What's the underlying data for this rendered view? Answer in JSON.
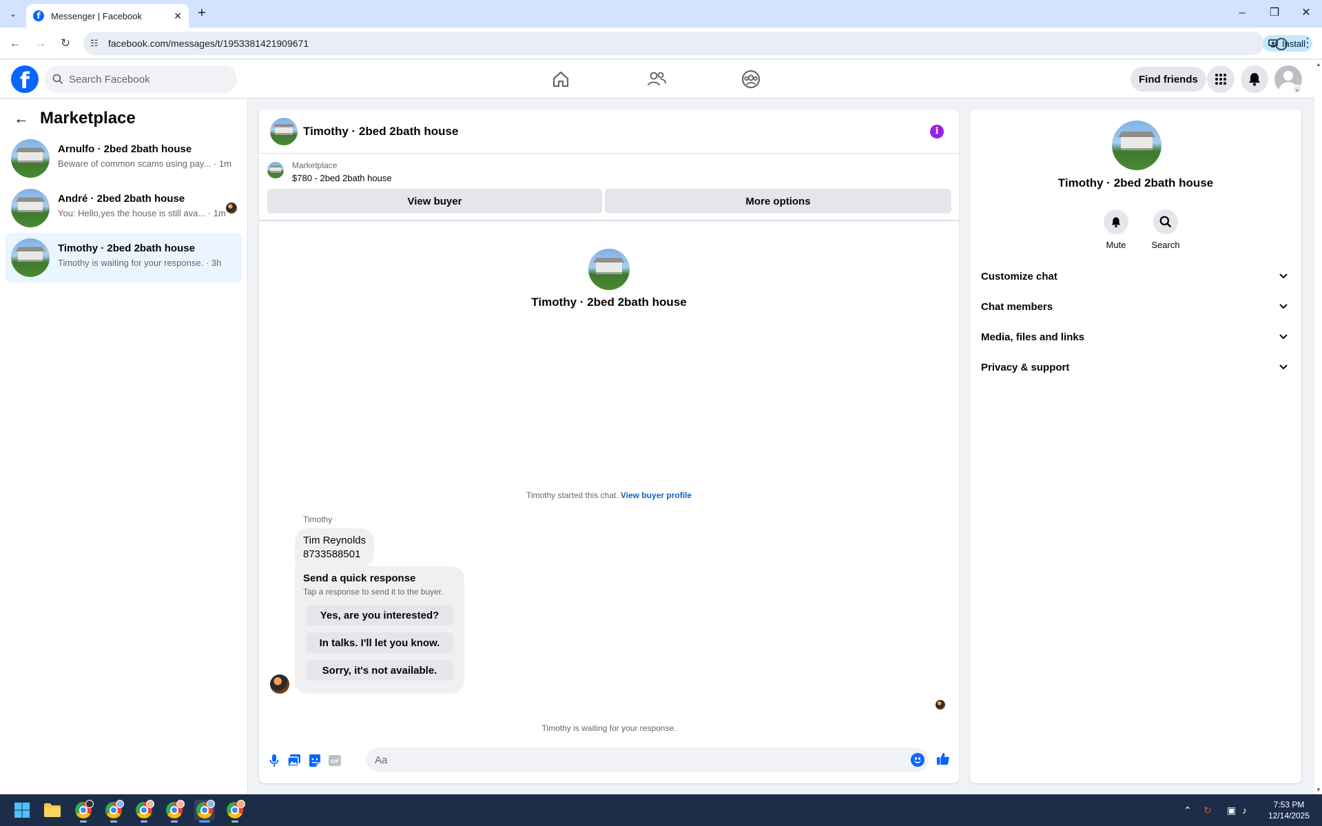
{
  "browser": {
    "tab_title": "Messenger | Facebook",
    "url": "facebook.com/messages/t/1953381421909671",
    "install_label": "Install"
  },
  "fb_header": {
    "search_placeholder": "Search Facebook",
    "find_friends_label": "Find friends",
    "brand_color": "#0866ff"
  },
  "sidebar": {
    "title": "Marketplace",
    "conversations": [
      {
        "name": "Arnulfo · 2bed 2bath house",
        "preview": "Beware of common scams using pay... · 1m",
        "active": false
      },
      {
        "name": "André · 2bed 2bath house",
        "preview": "You: Hello,yes the house is still ava... · 1m",
        "active": false
      },
      {
        "name": "Timothy · 2bed 2bath house",
        "preview": "Timothy is waiting for your response. · 3h",
        "active": true
      }
    ]
  },
  "chat": {
    "title": "Timothy · 2bed 2bath house",
    "marketplace_label": "Marketplace",
    "listing": "$780 - 2bed 2bath house",
    "view_buyer_label": "View buyer",
    "more_options_label": "More options",
    "intro_name": "Timothy · 2bed 2bath house",
    "started_text": "Timothy started this chat.",
    "view_buyer_profile_label": "View buyer profile",
    "sender_name": "Timothy",
    "message_line1": "Tim Reynolds",
    "message_line2": "8733588501",
    "quick_response": {
      "title": "Send a quick response",
      "subtitle": "Tap a response to send it to the buyer.",
      "options": [
        "Yes, are you interested?",
        "In talks. I'll let you know.",
        "Sorry, it's not available."
      ]
    },
    "waiting_text": "Timothy is waiting for your response.",
    "input_placeholder": "Aa",
    "accent_color": "#0866ff"
  },
  "info_panel": {
    "name": "Timothy · 2bed 2bath house",
    "actions": [
      {
        "label": "Mute",
        "icon": "bell-icon"
      },
      {
        "label": "Search",
        "icon": "search-icon"
      }
    ],
    "sections": [
      "Customize chat",
      "Chat members",
      "Media, files and links",
      "Privacy & support"
    ]
  },
  "taskbar": {
    "time": "7:53 PM",
    "date": "12/14/2025"
  }
}
